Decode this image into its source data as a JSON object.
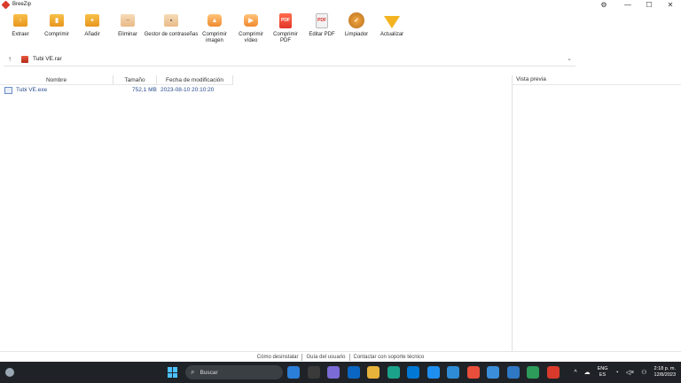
{
  "window": {
    "title": "BreeZip",
    "controls": {
      "settings": "⚙",
      "minimize": "—",
      "maximize": "☐",
      "close": "✕"
    }
  },
  "toolbar": {
    "items": [
      {
        "label": "Extraer",
        "icon": "extract-icon"
      },
      {
        "label": "Comprimir",
        "icon": "compress-icon"
      },
      {
        "label": "Añadir",
        "icon": "add-icon"
      },
      {
        "label": "Eliminar",
        "icon": "delete-icon"
      },
      {
        "label": "Gestor de contraseñas",
        "icon": "password-manager-icon"
      },
      {
        "label": "Comprimir imagen",
        "icon": "compress-image-icon"
      },
      {
        "label": "Comprimir vídeo",
        "icon": "compress-video-icon"
      },
      {
        "label": "Comprimir PDF",
        "icon": "compress-pdf-icon"
      },
      {
        "label": "Editar PDF",
        "icon": "edit-pdf-icon"
      },
      {
        "label": "Limpiador",
        "icon": "cleaner-icon"
      },
      {
        "label": "Actualizar",
        "icon": "upgrade-icon"
      }
    ]
  },
  "address": {
    "path": "Tubi VE.rar",
    "up": "↑",
    "dropdown": "⌄"
  },
  "filelist": {
    "columns": {
      "name": "Nombre",
      "size": "Tamaño",
      "modified": "Fecha de modificación"
    },
    "rows": [
      {
        "name": "Tubi VE.exe",
        "size": "752,1 MB",
        "modified": "2023-08-10 20:10:20"
      }
    ]
  },
  "preview": {
    "title": "Vista previa"
  },
  "footer": {
    "uninstall": "Cómo desinstalar",
    "guide": "Guía del usuario",
    "support": "Contactar con soporte técnico"
  },
  "taskbar": {
    "search_label": "Buscar",
    "search_icon": "⌕",
    "language": {
      "line1": "ENG",
      "line2": "ES"
    },
    "clock": {
      "time": "2:18 p. m.",
      "date": "12/8/2023"
    },
    "tray_chevron": "^",
    "cloud": "☁",
    "wifi": "◔",
    "volume": "◁×",
    "battery": "⚇",
    "app_colors": [
      "#2b7fd8",
      "#3a3a3a",
      "#7b6bd6",
      "#0a66c2",
      "#e8b33a",
      "#1aa38a",
      "#0078d4",
      "#1f8ef1",
      "#2e8cd6",
      "#e94e3a",
      "#3b8ed9",
      "#2f78c4",
      "#2d9b5a",
      "#d93a2b"
    ]
  }
}
